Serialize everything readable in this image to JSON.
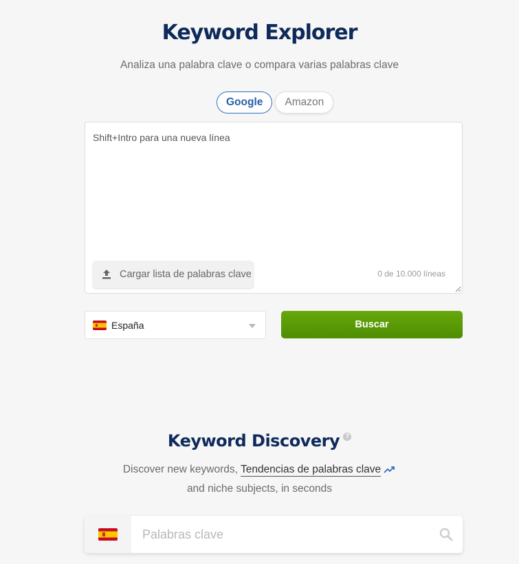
{
  "explorer": {
    "title": "Keyword Explorer",
    "subtitle": "Analiza una palabra clave o compara varias palabras clave",
    "tabs": [
      {
        "label": "Google",
        "active": true
      },
      {
        "label": "Amazon",
        "active": false
      }
    ],
    "textarea_placeholder": "Shift+Intro para una nueva línea",
    "upload_label": "Cargar lista de palabras clave",
    "line_count": "0 de 10.000 líneas",
    "country": "España",
    "search_button": "Buscar"
  },
  "discovery": {
    "title": "Keyword Discovery",
    "help_glyph": "?",
    "desc_before": "Discover new keywords,",
    "trends_link": "Tendencias de palabras clave",
    "desc_line2": "and niche subjects, in seconds",
    "search_placeholder": "Palabras clave"
  },
  "colors": {
    "title": "#0e2a5a",
    "accent_blue": "#2f6fbf",
    "button_green": "#5a9a07",
    "background": "#f6f6f7"
  },
  "icons": [
    "upload-icon",
    "chevron-down-icon",
    "spain-flag-icon",
    "help-icon",
    "trend-icon",
    "search-icon"
  ]
}
